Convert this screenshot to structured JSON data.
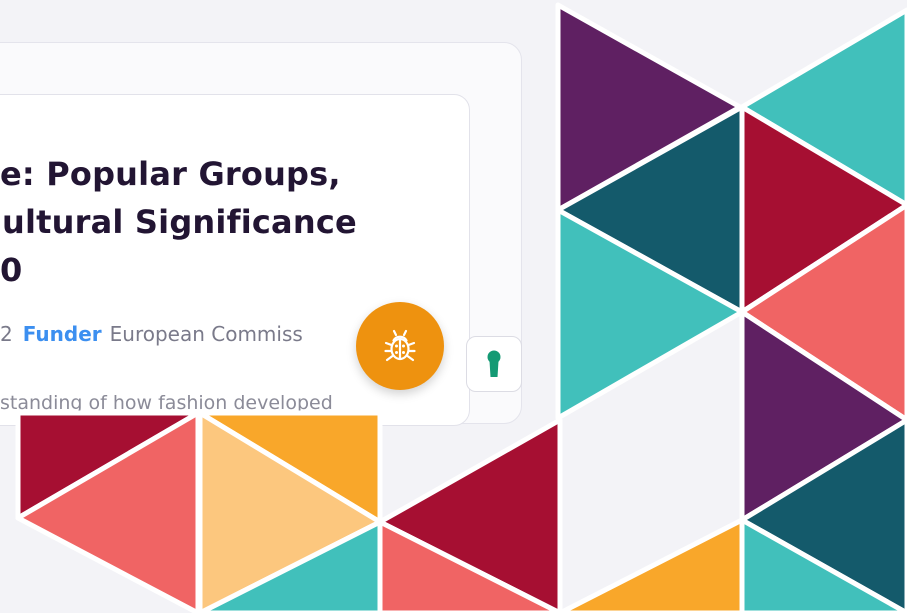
{
  "card": {
    "title_lines": [
      "e: Popular Groups,",
      "ultural Significance",
      "0"
    ],
    "meta": {
      "year_fragment": "2",
      "funder_label": "Funder",
      "funder_value": "European Commiss"
    },
    "description_fragment": "standing of how fashion developed"
  },
  "buttons": {
    "bug_icon": "ladybug-icon",
    "keyhole_icon": "keyhole-icon"
  },
  "colors": {
    "purple": "#5f2062",
    "teal": "#41c0bb",
    "dark_teal": "#145a6b",
    "crimson": "#a60f32",
    "coral": "#f06464",
    "orange": "#f9a72a",
    "light_orange": "#fcc77e",
    "button_orange": "#ee920f",
    "funder_blue": "#3c8ff0",
    "title_dark": "#221533"
  }
}
